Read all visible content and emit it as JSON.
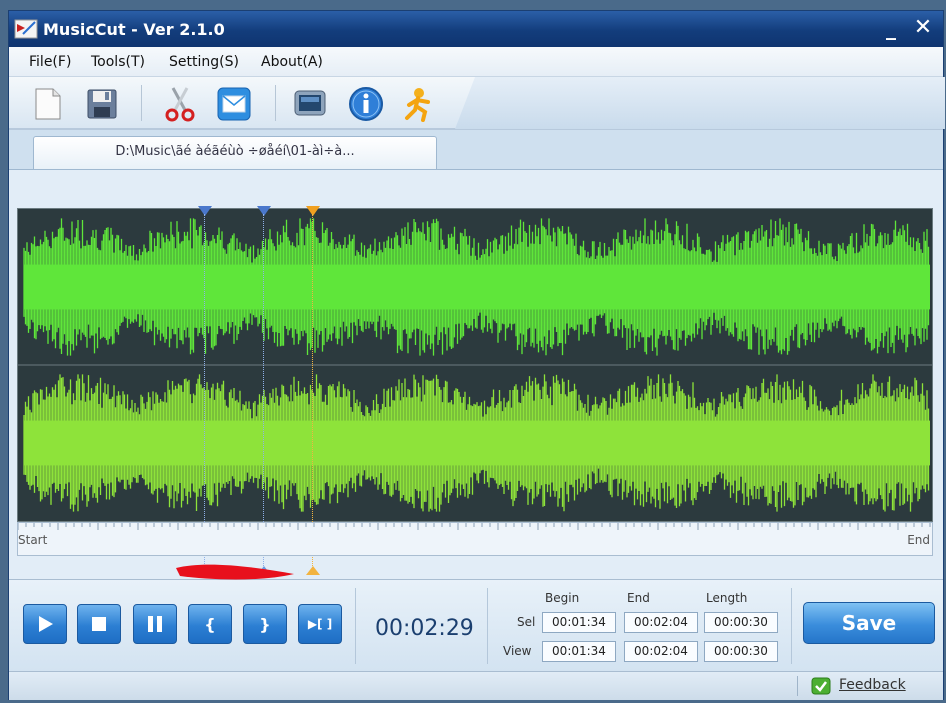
{
  "window": {
    "title": "MusicCut - Ver 2.1.0",
    "minimize": "_",
    "close": "✕"
  },
  "menu": [
    {
      "label": "File(F)"
    },
    {
      "label": "Tools(T)"
    },
    {
      "label": "Setting(S)"
    },
    {
      "label": "About(A)"
    }
  ],
  "toolbar": {
    "buttons": [
      "new-file-icon",
      "save-disk-icon",
      "scissors-icon",
      "mail-icon",
      "monitor-icon",
      "info-icon",
      "runner-icon"
    ]
  },
  "tab": {
    "label": "D:\\Music\\ãé àéãéùò ÷øåéí\\01-àì÷à..."
  },
  "waveform": {
    "start_label": "Start",
    "end_label": "End",
    "colors": {
      "background": "#2c3a3e",
      "channel_top": "#5fe63a",
      "channel_bottom": "#8ee33a",
      "marker_blue": "#3a66c4",
      "marker_orange": "#f0a020"
    }
  },
  "controls": {
    "buttons": [
      "play-icon",
      "stop-icon",
      "pause-icon",
      "set-begin-icon",
      "set-end-icon",
      "play-selection-icon"
    ],
    "set_begin_glyph": "{",
    "set_end_glyph": "}",
    "play_sel_glyph": "▶[ ]",
    "current_time": "00:02:29",
    "headers": {
      "begin": "Begin",
      "end": "End",
      "length": "Length"
    },
    "sel": {
      "label": "Sel",
      "begin": "00:01:34",
      "end": "00:02:04",
      "length": "00:00:30"
    },
    "view": {
      "label": "View",
      "begin": "00:01:34",
      "end": "00:02:04",
      "length": "00:00:30"
    },
    "save_label": "Save"
  },
  "status": {
    "feedback_label": "Feedback"
  }
}
